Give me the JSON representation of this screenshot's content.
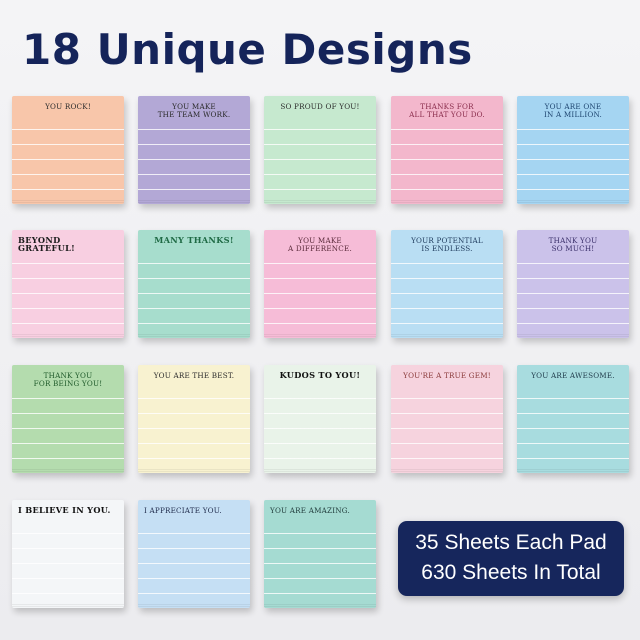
{
  "title": "18 Unique Designs",
  "badge": {
    "line1": "35 Sheets Each Pad",
    "line2": "630 Sheets In Total"
  },
  "notes": [
    {
      "text": "YOU ROCK!",
      "color": "#f8c6aa",
      "text_color": "#2b2b2b",
      "align": "center"
    },
    {
      "text": "YOU MAKE\nTHE TEAM WORK.",
      "color": "#b3a8d6",
      "text_color": "#2b2b2b",
      "align": "center"
    },
    {
      "text": "SO PROUD OF YOU!",
      "color": "#c6e9cf",
      "text_color": "#2b2b2b",
      "align": "center"
    },
    {
      "text": "THANKS FOR\nALL THAT YOU DO.",
      "color": "#f3b7cc",
      "text_color": "#8a2d4c",
      "align": "center"
    },
    {
      "text": "YOU ARE ONE\nIN A MILLION.",
      "color": "#a5d5f2",
      "text_color": "#1e4570",
      "align": "center"
    },
    {
      "text": "BEYOND GRATEFUL!",
      "color": "#f8cfe1",
      "text_color": "#1c1c1c",
      "align": "left",
      "bold": true
    },
    {
      "text": "MANY THANKS!",
      "color": "#a7ddcd",
      "text_color": "#1f6a45",
      "align": "center",
      "bold": true
    },
    {
      "text": "YOU MAKE\nA DIFFERENCE.",
      "color": "#f6bcd7",
      "text_color": "#5a2a3a",
      "align": "center"
    },
    {
      "text": "YOUR POTENTIAL\nIS ENDLESS.",
      "color": "#b9def3",
      "text_color": "#1e3a5c",
      "align": "center"
    },
    {
      "text": "THANK YOU\nSO MUCH!",
      "color": "#cbc2ea",
      "text_color": "#3a2f6a",
      "align": "center"
    },
    {
      "text": "THANK YOU\nFOR BEING YOU!",
      "color": "#b4dcae",
      "text_color": "#1f5a2a",
      "align": "center"
    },
    {
      "text": "YOU ARE THE BEST.",
      "color": "#f8f2d0",
      "text_color": "#2b2b2b",
      "align": "center"
    },
    {
      "text": "KUDOS TO YOU!",
      "color": "#e9f3e9",
      "text_color": "#111111",
      "align": "center",
      "bold": true
    },
    {
      "text": "YOU'RE A TRUE GEM!",
      "color": "#f6d3de",
      "text_color": "#8a3a3a",
      "align": "center"
    },
    {
      "text": "YOU ARE AWESOME.",
      "color": "#a8dcdf",
      "text_color": "#1f3a4a",
      "align": "center"
    },
    {
      "text": "I BELIEVE IN YOU.",
      "color": "#f4f6f8",
      "text_color": "#111111",
      "align": "left",
      "bold": true
    },
    {
      "text": "I APPRECIATE YOU.",
      "color": "#c5dff4",
      "text_color": "#1e2a4a",
      "align": "left"
    },
    {
      "text": "YOU ARE AMAZING.",
      "color": "#a5dbd2",
      "text_color": "#1f3a3a",
      "align": "left"
    }
  ]
}
